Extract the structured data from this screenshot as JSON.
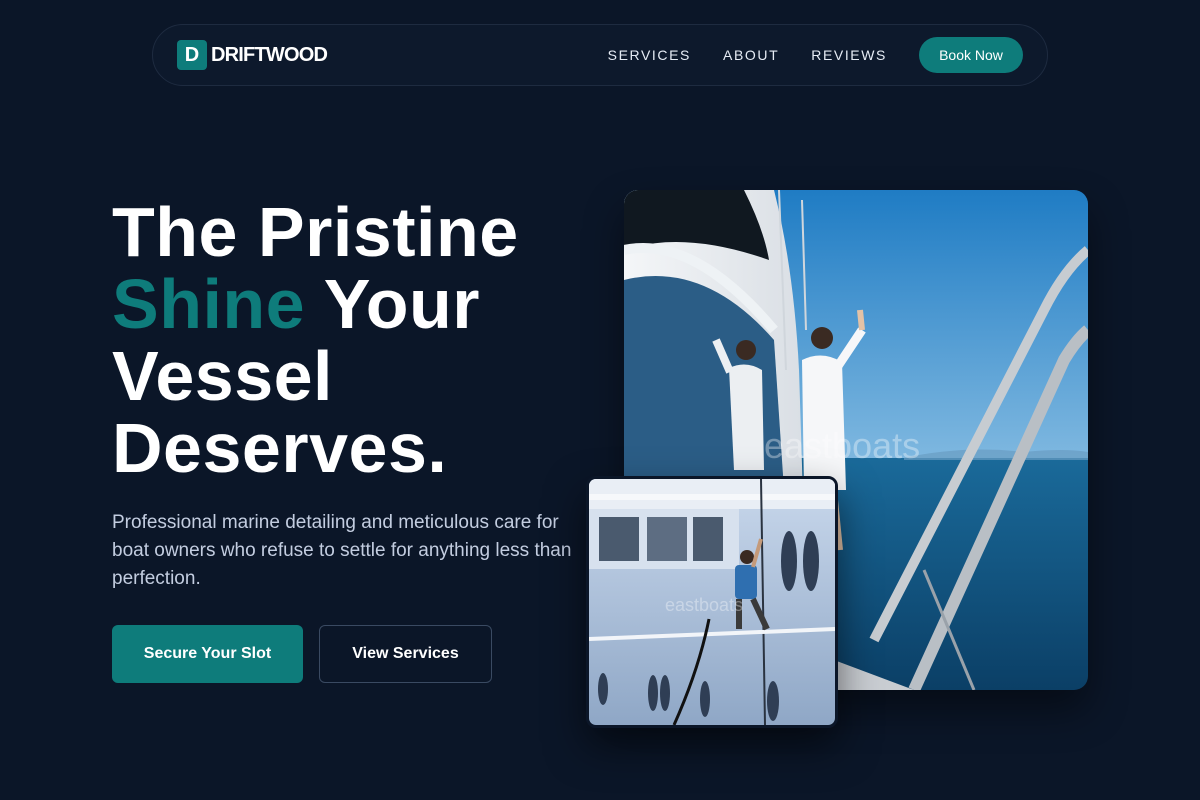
{
  "brand": {
    "mark": "D",
    "name": "DRIFTWOOD",
    "accent": "#0e7c7b"
  },
  "nav": {
    "links": [
      "SERVICES",
      "ABOUT",
      "REVIEWS"
    ],
    "cta": "Book Now"
  },
  "hero": {
    "title_line1": "The Pristine",
    "title_accent": "Shine",
    "title_line2_rest": " Your",
    "title_line3": "Vessel",
    "title_line4": "Deserves.",
    "subtitle": "Professional marine detailing and meticulous care for boat owners who refuse to settle for anything less than perfection.",
    "primary_cta": "Secure Your Slot",
    "secondary_cta": "View Services"
  },
  "images": {
    "main_watermark": "eastboats",
    "small_watermark": "eastboats"
  },
  "colors": {
    "background": "#0b1628",
    "accent": "#0e7c7b",
    "text_muted": "#c3cde0"
  }
}
